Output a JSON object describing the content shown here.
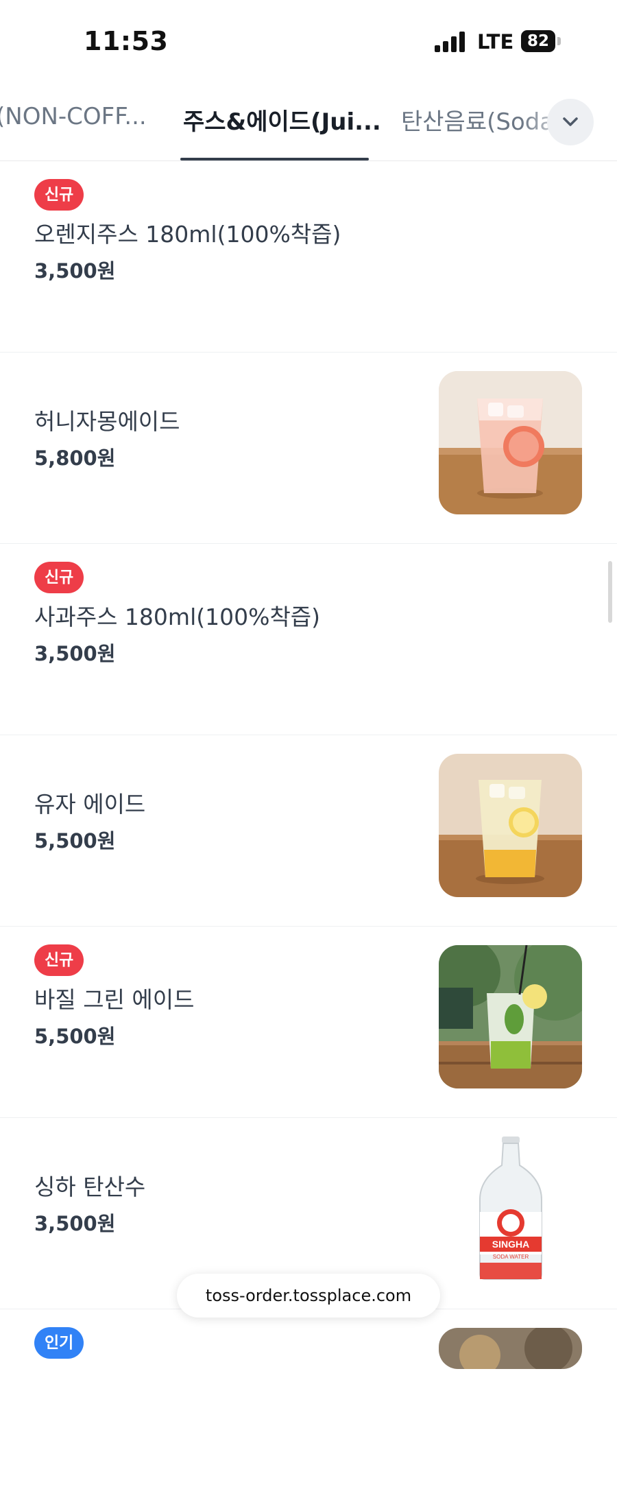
{
  "status_bar": {
    "time": "11:53",
    "network": "LTE",
    "battery": "82"
  },
  "tabs": [
    {
      "label": "(NON-COFF..."
    },
    {
      "label": "주스&에이드(Jui..."
    },
    {
      "label": "탄산음료(Soda"
    }
  ],
  "menu_items": [
    {
      "badge": "신규",
      "name": "오렌지주스 180ml(100%착즙)",
      "price": "3,500원"
    },
    {
      "name": "허니자몽에이드",
      "price": "5,800원",
      "image": "grapefruit-ade-photo"
    },
    {
      "badge": "신규",
      "name": "사과주스 180ml(100%착즙)",
      "price": "3,500원"
    },
    {
      "name": "유자 에이드",
      "price": "5,500원",
      "image": "yuzu-ade-photo"
    },
    {
      "badge": "신규",
      "name": "바질 그린 에이드",
      "price": "5,500원",
      "image": "basil-green-ade-photo"
    },
    {
      "name": "싱하 탄산수",
      "price": "3,500원",
      "image": "singha-soda-bottle-photo"
    },
    {
      "badge": "인기",
      "image": "partial-item-photo"
    }
  ],
  "bottle_label": {
    "brand": "SINGHA",
    "sub": "SODA WATER"
  },
  "url_bar": {
    "url": "toss-order.tossplace.com"
  },
  "colors": {
    "new_badge": "#ee3d48",
    "popular_badge": "#3182f6",
    "text": "#333d4b",
    "tab_inactive": "#6b7684"
  }
}
